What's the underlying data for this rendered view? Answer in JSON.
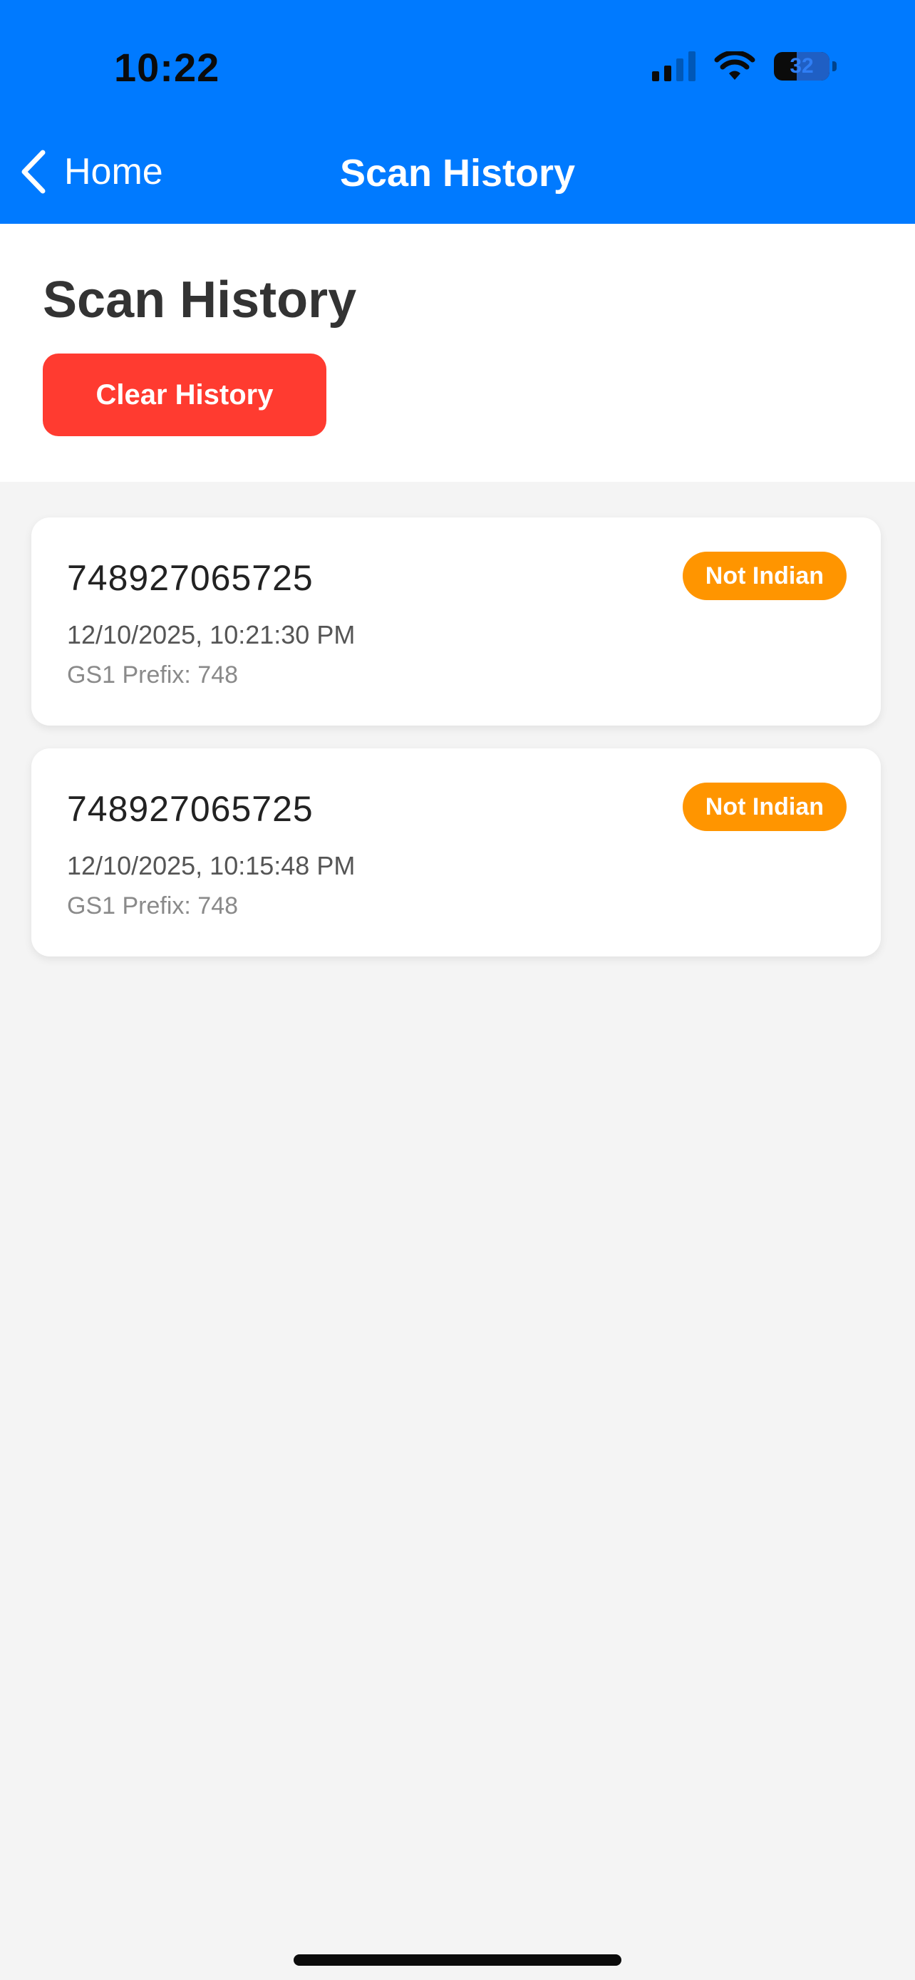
{
  "status_bar": {
    "time": "10:22",
    "battery_level": "32"
  },
  "nav_bar": {
    "back_label": "Home",
    "title": "Scan History"
  },
  "header": {
    "title": "Scan History",
    "clear_button_label": "Clear History"
  },
  "history": [
    {
      "barcode": "748927065725",
      "timestamp": "12/10/2025, 10:21:30 PM",
      "gs1_prefix": "GS1 Prefix: 748",
      "badge": "Not Indian"
    },
    {
      "barcode": "748927065725",
      "timestamp": "12/10/2025, 10:15:48 PM",
      "gs1_prefix": "GS1 Prefix: 748",
      "badge": "Not Indian"
    }
  ],
  "colors": {
    "nav_background": "#007aff",
    "clear_button": "#ff3b30",
    "badge_not_indian": "#ff9500",
    "page_background": "#f4f4f4"
  },
  "icons": {
    "back": "chevron-left-icon",
    "signal": "cellular-signal-icon",
    "wifi": "wifi-icon",
    "battery": "battery-icon"
  }
}
